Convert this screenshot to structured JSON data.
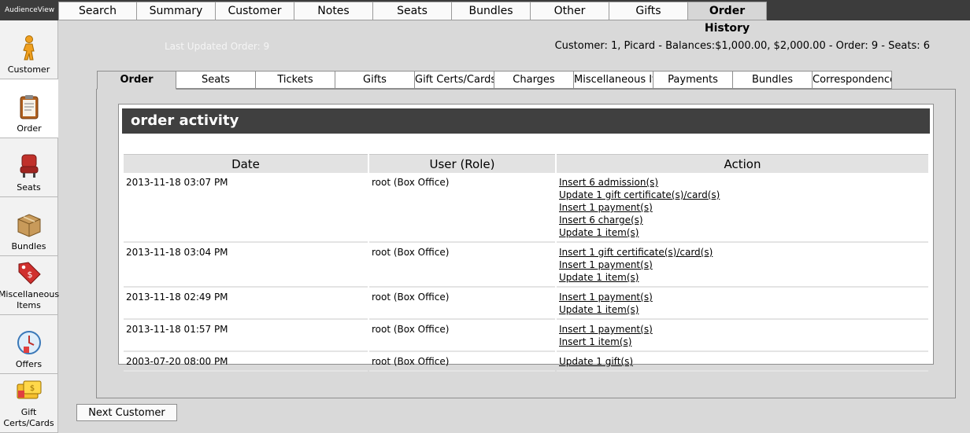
{
  "app": {
    "brand": "AudienceView"
  },
  "top_nav": {
    "tabs": [
      "Search",
      "Summary",
      "Customer",
      "Notes",
      "Seats",
      "Bundles",
      "Other",
      "Gifts",
      "Order History"
    ],
    "active": "Order History"
  },
  "side_nav": {
    "items": [
      {
        "label": "Customer",
        "icon": "person-icon"
      },
      {
        "label": "Order",
        "icon": "clipboard-icon"
      },
      {
        "label": "Seats",
        "icon": "seat-icon"
      },
      {
        "label": "Bundles",
        "icon": "box-icon"
      },
      {
        "label": "Miscellaneous Items",
        "icon": "price-tag-icon"
      },
      {
        "label": "Offers",
        "icon": "clock-icon"
      },
      {
        "label": "Gift Certs/Cards",
        "icon": "gift-card-icon"
      }
    ],
    "active": "Order"
  },
  "header": {
    "last_updated": "Last Updated Order: 9",
    "customer_info": "Customer: 1, Picard - Balances:$1,000.00, $2,000.00 - Order: 9 - Seats: 6"
  },
  "sub_tabs": {
    "tabs": [
      "Order",
      "Seats",
      "Tickets",
      "Gifts",
      "Gift Certs/Cards",
      "Charges",
      "Miscellaneous Items",
      "Payments",
      "Bundles",
      "Correspondence"
    ],
    "active": "Order"
  },
  "activity": {
    "title": "order activity",
    "columns": [
      "Date",
      "User (Role)",
      "Action"
    ],
    "rows": [
      {
        "date": "2013-11-18 03:07 PM",
        "user": "root (Box Office)",
        "actions": [
          "Insert 6 admission(s)",
          "Update 1 gift certificate(s)/card(s)",
          "Insert 1 payment(s)",
          "Insert 6 charge(s)",
          "Update 1 item(s)"
        ]
      },
      {
        "date": "2013-11-18 03:04 PM",
        "user": "root (Box Office)",
        "actions": [
          "Insert 1 gift certificate(s)/card(s)",
          "Insert 1 payment(s)",
          "Update 1 item(s)"
        ]
      },
      {
        "date": "2013-11-18 02:49 PM",
        "user": "root (Box Office)",
        "actions": [
          "Insert 1 payment(s)",
          "Update 1 item(s)"
        ]
      },
      {
        "date": "2013-11-18 01:57 PM",
        "user": "root (Box Office)",
        "actions": [
          "Insert 1 payment(s)",
          "Insert 1 item(s)"
        ]
      },
      {
        "date": "2003-07-20 08:00 PM",
        "user": "root (Box Office)",
        "actions": [
          "Update 1 gift(s)"
        ]
      }
    ]
  },
  "footer": {
    "next_customer_label": "Next Customer"
  }
}
